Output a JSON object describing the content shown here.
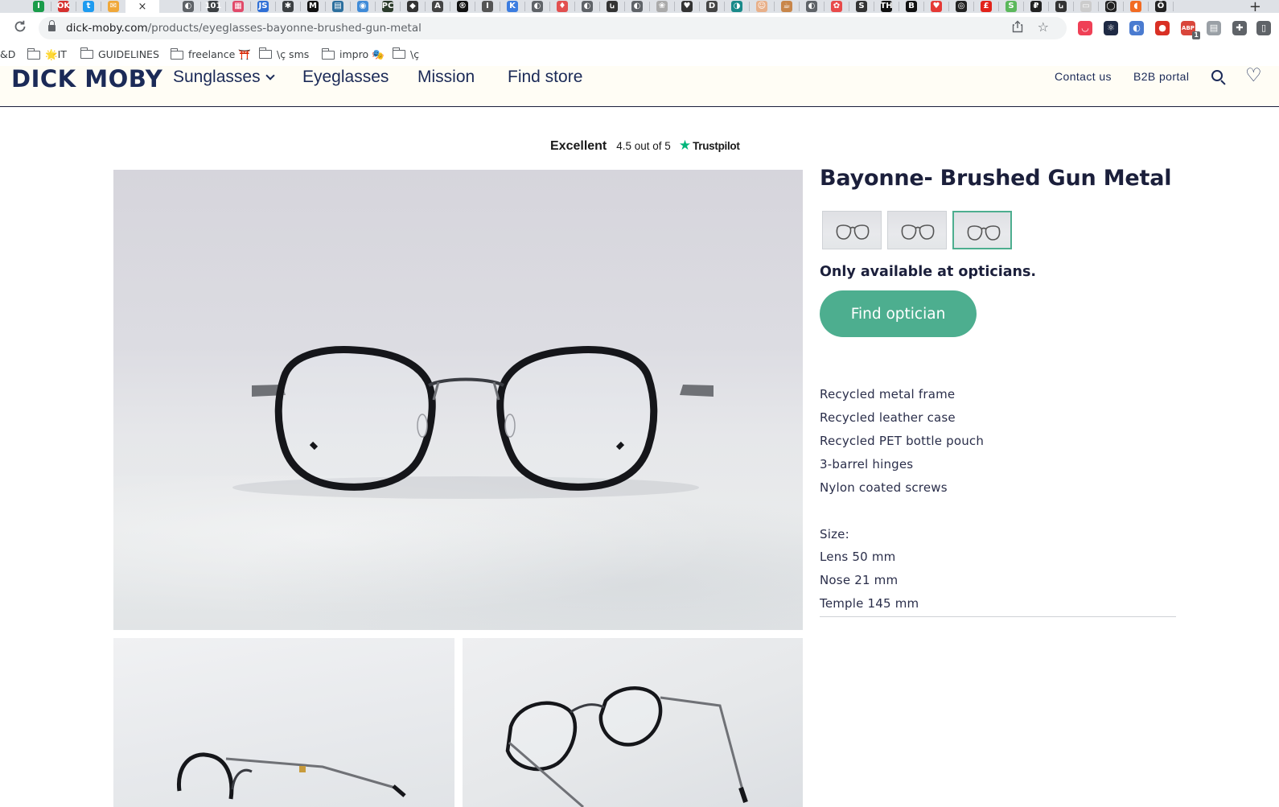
{
  "browser": {
    "active_tab_close": "×",
    "new_tab": "+",
    "url_host": "dick-moby.com",
    "url_path": "/products/eyeglasses-bayonne-brushed-gun-metal",
    "tab_favicons": [
      {
        "glyph": "I",
        "color": "#1a9c4a"
      },
      {
        "glyph": "OK",
        "color": "#d6302f"
      },
      {
        "glyph": "t",
        "color": "#1d9bf0"
      },
      {
        "glyph": "✉",
        "color": "#f0a83a"
      },
      {
        "glyph": "✳",
        "color": "#e2543b"
      },
      {
        "glyph": "◐",
        "color": "#5f6368"
      },
      {
        "glyph": "101",
        "color": "#3c4043"
      },
      {
        "glyph": "▦",
        "color": "#e14a6a"
      },
      {
        "glyph": "JS",
        "color": "#2f6fd6"
      },
      {
        "glyph": "✱",
        "color": "#3c4043"
      },
      {
        "glyph": "M",
        "color": "#111111"
      },
      {
        "glyph": "▤",
        "color": "#2c6f9e"
      },
      {
        "glyph": "◉",
        "color": "#3f8bd8"
      },
      {
        "glyph": "PC",
        "color": "#2b3b2b"
      },
      {
        "glyph": "◆",
        "color": "#333333"
      },
      {
        "glyph": "A",
        "color": "#444444"
      },
      {
        "glyph": "®",
        "color": "#111111"
      },
      {
        "glyph": "I",
        "color": "#555555"
      },
      {
        "glyph": "K",
        "color": "#3c7de0"
      },
      {
        "glyph": "◐",
        "color": "#5f6368"
      },
      {
        "glyph": "♦",
        "color": "#e25050"
      },
      {
        "glyph": "◐",
        "color": "#5f6368"
      },
      {
        "glyph": "ꭎ",
        "color": "#333333"
      },
      {
        "glyph": "◐",
        "color": "#5f6368"
      },
      {
        "glyph": "❀",
        "color": "#aaaaaa"
      },
      {
        "glyph": "♥",
        "color": "#333333"
      },
      {
        "glyph": "D",
        "color": "#444444"
      },
      {
        "glyph": "◑",
        "color": "#1a8a8a"
      },
      {
        "glyph": "☺",
        "color": "#e8b08a"
      },
      {
        "glyph": "☕",
        "color": "#c8864a"
      },
      {
        "glyph": "◐",
        "color": "#5f6368"
      },
      {
        "glyph": "✿",
        "color": "#e84a4a"
      },
      {
        "glyph": "S",
        "color": "#333333"
      },
      {
        "glyph": "TH",
        "color": "#111111"
      },
      {
        "glyph": "B",
        "color": "#111111"
      },
      {
        "glyph": "♥",
        "color": "#e53935"
      },
      {
        "glyph": "◎",
        "color": "#222222"
      },
      {
        "glyph": "£",
        "color": "#e2231a"
      },
      {
        "glyph": "S",
        "color": "#5cb85c"
      },
      {
        "glyph": "₽",
        "color": "#222222"
      },
      {
        "glyph": "ꭎ",
        "color": "#333333"
      },
      {
        "glyph": "▭",
        "color": "#cccccc"
      },
      {
        "glyph": "◯",
        "color": "#222222"
      },
      {
        "glyph": "◖",
        "color": "#f26b22"
      },
      {
        "glyph": "Ö",
        "color": "#222222"
      }
    ],
    "extensions": [
      {
        "name": "pocket",
        "glyph": "◡",
        "color": "#ef4056"
      },
      {
        "name": "react-devtools",
        "glyph": "⚛",
        "color": "#1f2a44"
      },
      {
        "name": "extension-blue",
        "glyph": "◐",
        "color": "#4a7bd0"
      },
      {
        "name": "extension-red",
        "glyph": "●",
        "color": "#d93025"
      },
      {
        "name": "adblock",
        "glyph": "ABP",
        "color": "#d9463b"
      },
      {
        "name": "extension-gray",
        "glyph": "▤",
        "color": "#9aa0a6"
      },
      {
        "name": "puzzle",
        "glyph": "✚",
        "color": "#5f6368"
      },
      {
        "name": "sidebar",
        "glyph": "▯",
        "color": "#5f6368"
      }
    ],
    "adblock_badge": "1"
  },
  "bookmarks": [
    {
      "label": "&D",
      "folder": false
    },
    {
      "label": "🌟IT",
      "folder": true
    },
    {
      "label": "GUIDELINES",
      "folder": true
    },
    {
      "label": "freelance ⛩️",
      "folder": true
    },
    {
      "label": "\\ç sms",
      "folder": true
    },
    {
      "label": "impro 🎭",
      "folder": true
    },
    {
      "label": "\\ç",
      "folder": true
    }
  ],
  "site": {
    "logo": "DICK MOBY",
    "nav": {
      "sunglasses": "Sunglasses",
      "eyeglasses": "Eyeglasses",
      "mission": "Mission",
      "find_store": "Find store"
    },
    "nav_right": {
      "contact": "Contact us",
      "b2b": "B2B portal"
    }
  },
  "trustpilot": {
    "label": "Excellent",
    "rating": "4.5 out of 5",
    "brand": "Trustpilot"
  },
  "product": {
    "title": "Bayonne- Brushed Gun Metal",
    "availability": "Only available at opticians.",
    "cta": "Find optician",
    "features": [
      "Recycled metal frame",
      "Recycled leather case",
      "Recycled PET bottle pouch",
      "3-barrel hinges",
      "Nylon coated screws"
    ],
    "size": {
      "heading": "Size:",
      "lens": "Lens 50 mm",
      "nose": "Nose 21 mm",
      "temple": "Temple 145 mm"
    },
    "selected_variant": 3,
    "frame_color": "#15161a",
    "hinge_color": "#6f7176"
  },
  "colors": {
    "brand_navy": "#1b2a57",
    "cta_green": "#4dae8f",
    "header_bg": "#fffdf5",
    "trustpilot_green": "#00b67a"
  }
}
